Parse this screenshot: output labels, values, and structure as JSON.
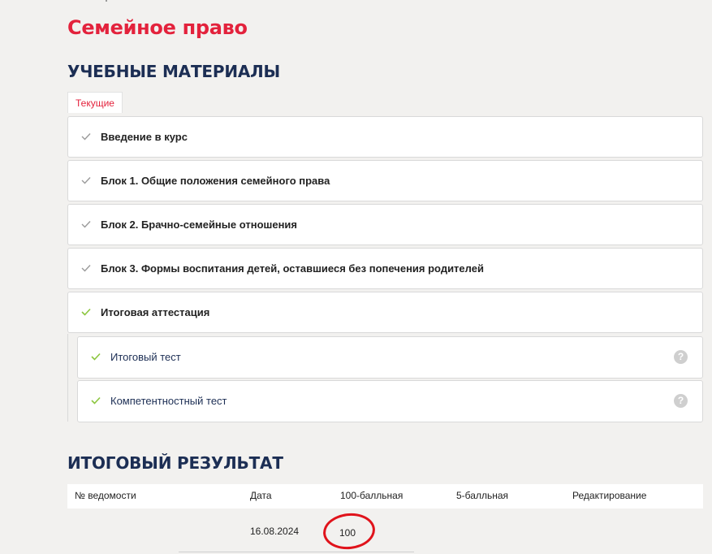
{
  "course": {
    "title": "Семейное право"
  },
  "materials": {
    "heading": "УЧЕБНЫЕ МАТЕРИАЛЫ",
    "tab_label": "Текущие",
    "items": [
      {
        "label": "Введение в курс",
        "status": "completed",
        "check_color": "#9a9a9a"
      },
      {
        "label": "Блок 1. Общие положения семейного права",
        "status": "completed",
        "check_color": "#9a9a9a"
      },
      {
        "label": "Блок 2. Брачно-семейные отношения",
        "status": "completed",
        "check_color": "#9a9a9a"
      },
      {
        "label": "Блок 3. Формы воспитания детей, оставшиеся без попечения родителей",
        "status": "completed",
        "check_color": "#9a9a9a"
      },
      {
        "label": "Итоговая аттестация",
        "status": "passed",
        "check_color": "#8cc63f"
      }
    ],
    "sub_items": [
      {
        "label": "Итоговый тест",
        "status": "passed",
        "help_icon": "?"
      },
      {
        "label": "Компетентностный тест",
        "status": "passed",
        "help_icon": "?"
      }
    ]
  },
  "results": {
    "heading": "ИТОГОВЫЙ РЕЗУЛЬТАТ",
    "columns": [
      "№ ведомости",
      "Дата",
      "100-балльная",
      "5-балльная",
      "Редактирование"
    ],
    "rows": [
      {
        "number": "",
        "date": "16.08.2024",
        "score_100": "100",
        "score_5": "",
        "edit": ""
      }
    ]
  },
  "colors": {
    "accent_red": "#e3223c",
    "heading_navy": "#1c2e54",
    "check_green": "#8cc63f",
    "annotation_red": "#e0131b"
  }
}
